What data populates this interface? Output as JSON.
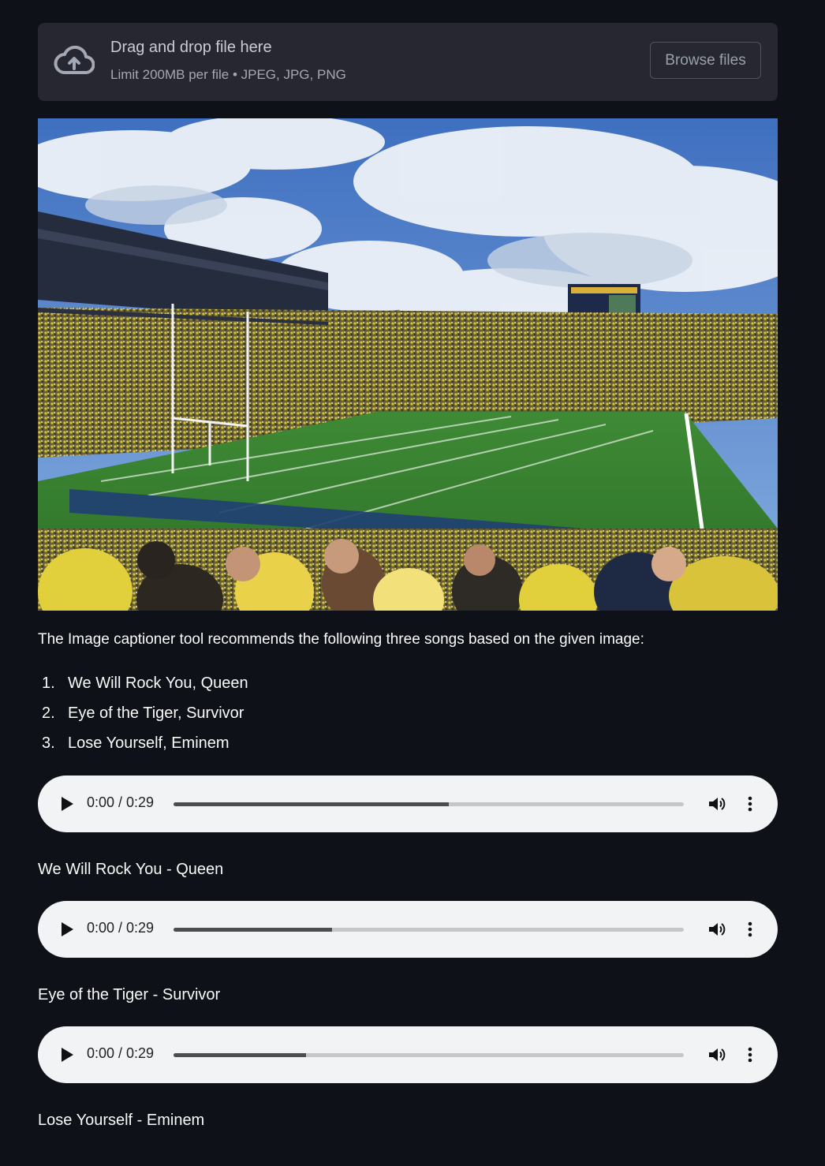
{
  "uploader": {
    "title": "Drag and drop file here",
    "limit": "Limit 200MB per file • JPEG, JPG, PNG",
    "browse_label": "Browse files",
    "icon": "cloud-upload-icon"
  },
  "image": {
    "subject": "stadium-photo"
  },
  "recommendation": {
    "intro": "The Image captioner tool recommends the following three songs based on the given image:",
    "songs": [
      {
        "num": "1.",
        "label": "We Will Rock You, Queen"
      },
      {
        "num": "2.",
        "label": "Eye of the Tiger, Survivor"
      },
      {
        "num": "3.",
        "label": "Lose Yourself, Eminem"
      }
    ]
  },
  "players": [
    {
      "time": "0:00 / 0:29",
      "buffered": 0.54,
      "caption": "We Will Rock You - Queen"
    },
    {
      "time": "0:00 / 0:29",
      "buffered": 0.31,
      "caption": "Eye of the Tiger - Survivor"
    },
    {
      "time": "0:00 / 0:29",
      "buffered": 0.26,
      "caption": "Lose Yourself - Eminem"
    }
  ],
  "colors": {
    "background": "#0e1117",
    "panel": "#262730",
    "player": "#f1f3f4"
  }
}
